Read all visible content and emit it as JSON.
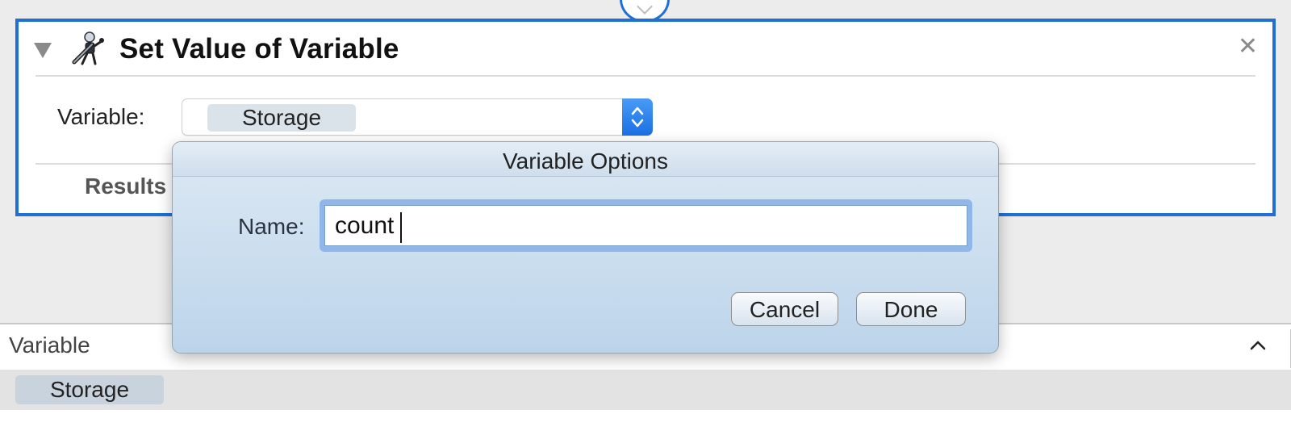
{
  "action": {
    "title": "Set Value of Variable",
    "variable_label": "Variable:",
    "variable_value": "Storage",
    "results_label": "Results",
    "icon": "automator-robot-icon",
    "close_icon": "close-icon",
    "accent_color": "#1f6fd6"
  },
  "popover": {
    "title": "Variable Options",
    "name_label": "Name:",
    "name_value": "count",
    "cancel_label": "Cancel",
    "done_label": "Done"
  },
  "variables_pane": {
    "header": "Variable",
    "items": [
      "Storage"
    ]
  }
}
